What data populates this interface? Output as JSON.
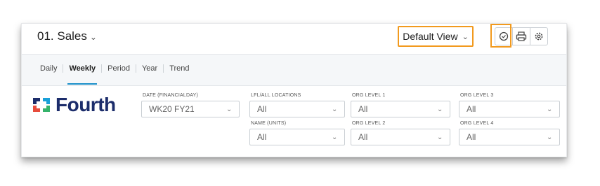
{
  "header": {
    "title": "01. Sales",
    "view_label": "Default View"
  },
  "toolbar": {
    "icons": [
      "clock-icon",
      "print-icon",
      "settings-icon"
    ]
  },
  "tabs": [
    "Daily",
    "Weekly",
    "Period",
    "Year",
    "Trend"
  ],
  "active_tab": "Weekly",
  "brand": {
    "name": "Fourth",
    "color": "#1c2d6b",
    "accent": "#f29a1e",
    "tab_underline": "#1a8fc9"
  },
  "filters": {
    "date": {
      "label": "DATE (FINANCIALDAY)",
      "value": "WK20 FY21"
    },
    "lfl": {
      "label": "LFL/ALL LOCATIONS",
      "value": "All"
    },
    "name": {
      "label": "NAME (UNITS)",
      "value": "All"
    },
    "org1": {
      "label": "ORG LEVEL 1",
      "value": "All"
    },
    "org2": {
      "label": "ORG LEVEL 2",
      "value": "All"
    },
    "org3": {
      "label": "ORG LEVEL 3",
      "value": "All"
    },
    "org4": {
      "label": "ORG LEVEL 4",
      "value": "All"
    }
  }
}
